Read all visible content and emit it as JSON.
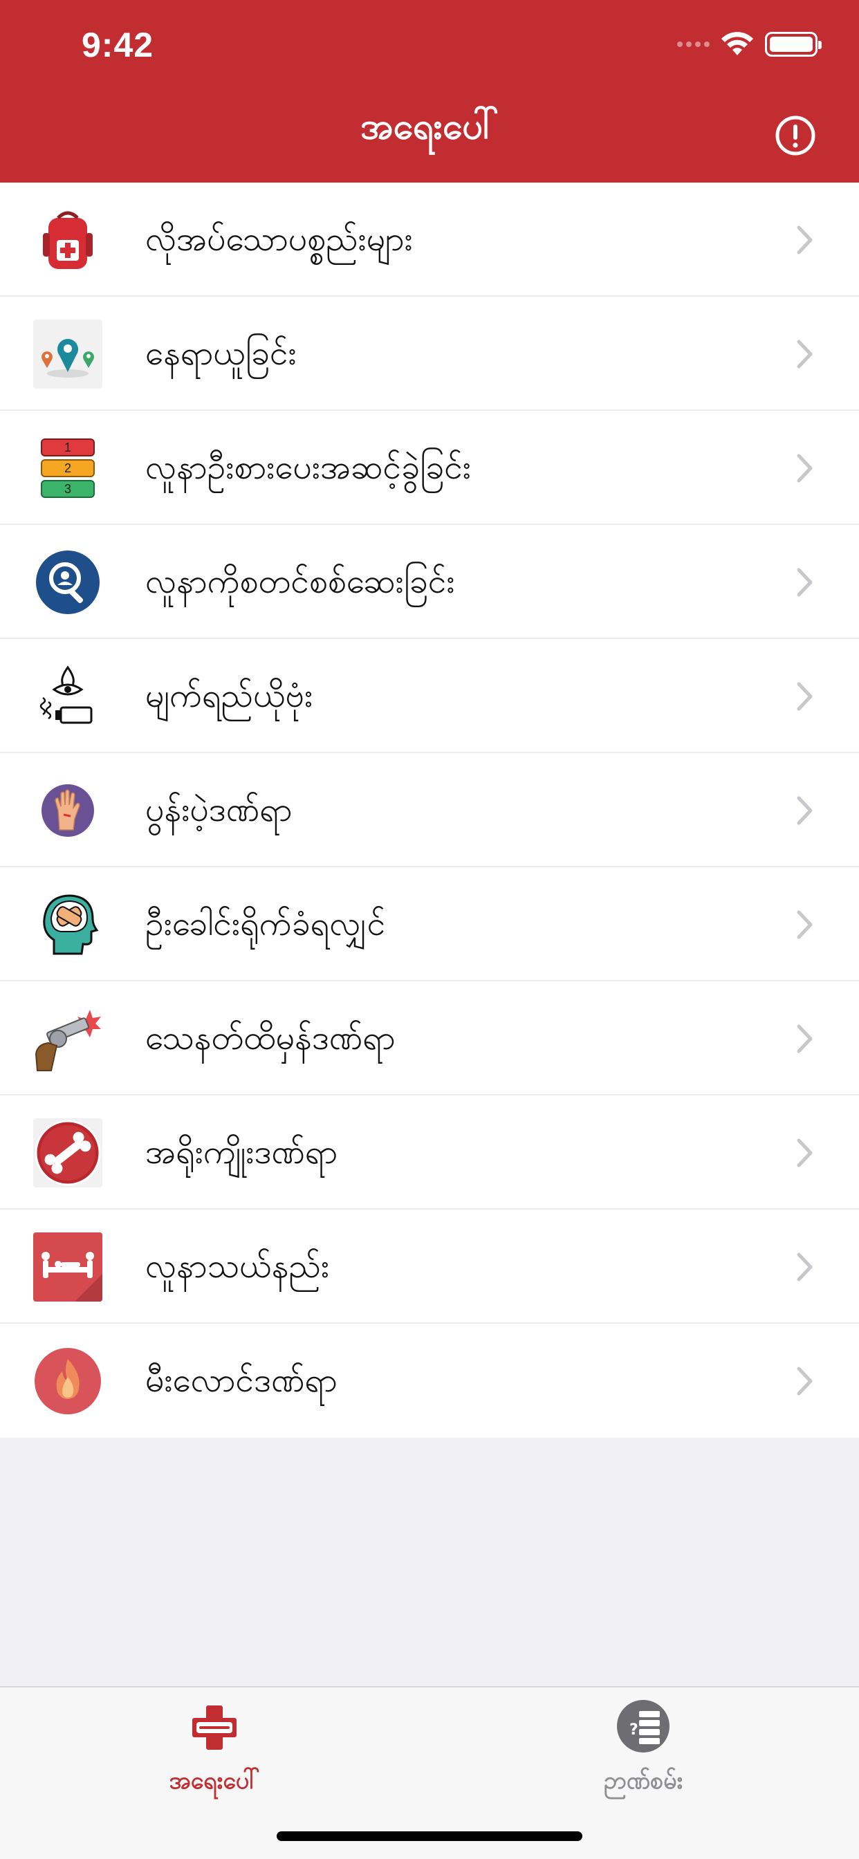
{
  "status_bar": {
    "time": "9:42"
  },
  "header": {
    "title": "အရေးပေါ်"
  },
  "menu": [
    {
      "label": "လိုအပ်သောပစ္စည်းများ",
      "icon": "first-aid-backpack-icon"
    },
    {
      "label": "နေရာယူခြင်း",
      "icon": "location-pins-icon"
    },
    {
      "label": "လူနာဦးစားပေးအဆင့်ခွဲခြင်း",
      "icon": "triage-numbers-icon",
      "badges": [
        "1",
        "2",
        "3"
      ]
    },
    {
      "label": "လူနာကိုစတင်စစ်ဆေးခြင်း",
      "icon": "patient-search-icon"
    },
    {
      "label": "မျက်ရည်ယိုဗုံး",
      "icon": "tear-gas-icon"
    },
    {
      "label": "ပွန်းပဲ့ဒဏ်ရာ",
      "icon": "hand-wound-icon"
    },
    {
      "label": "ဦးခေါင်းရိုက်ခံရလျှင်",
      "icon": "head-injury-icon"
    },
    {
      "label": "သေနတ်ထိမှန်ဒဏ်ရာ",
      "icon": "gun-wound-icon"
    },
    {
      "label": "အရိုးကျိုးဒဏ်ရာ",
      "icon": "broken-bone-icon"
    },
    {
      "label": "လူနာသယ်နည်း",
      "icon": "stretcher-carry-icon"
    },
    {
      "label": "မီးလောင်ဒဏ်ရာ",
      "icon": "burn-fire-icon"
    }
  ],
  "tabbar": {
    "home_label": "အရေးပေါ်",
    "knowledge_label": "ဉာဏ်စမ်း"
  },
  "colors": {
    "brand_red": "#c22d32",
    "tab_inactive": "#8e8e93"
  }
}
